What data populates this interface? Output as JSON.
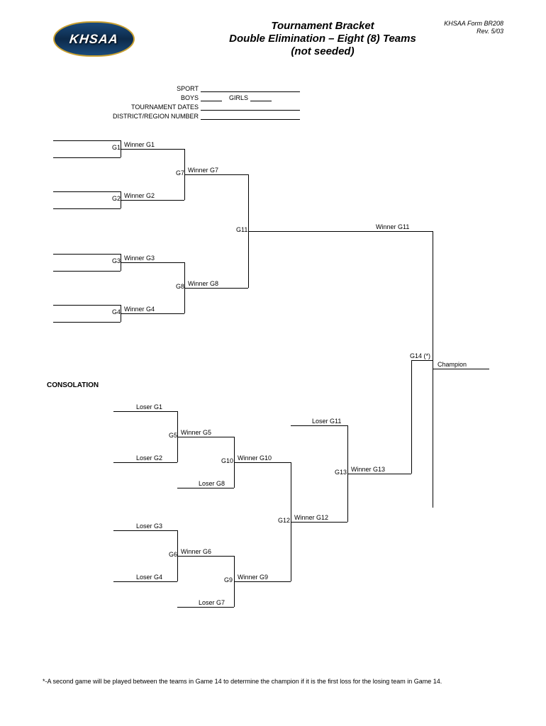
{
  "logo_text": "KHSAA",
  "form_info": {
    "form": "KHSAA Form BR208",
    "rev": "Rev. 5/03"
  },
  "title": {
    "line1": "Tournament Bracket",
    "line2": "Double Elimination – Eight (8) Teams",
    "line3": "(not seeded)"
  },
  "info": {
    "sport": "SPORT",
    "boys": "BOYS",
    "girls": "GIRLS",
    "dates": "TOURNAMENT DATES",
    "district": "DISTRICT/REGION NUMBER"
  },
  "consolation": "CONSOLATION",
  "labels": {
    "g1": "G1",
    "g2": "G2",
    "g3": "G3",
    "g4": "G4",
    "g5": "G5",
    "g6": "G6",
    "g7": "G7",
    "g8": "G8",
    "g9": "G9",
    "g10": "G10",
    "g11": "G11",
    "g12": "G12",
    "g13": "G13",
    "g14": "G14  (*)",
    "wg1": "Winner G1",
    "wg2": "Winner G2",
    "wg3": "Winner G3",
    "wg4": "Winner G4",
    "wg5": "Winner G5",
    "wg6": "Winner G6",
    "wg7": "Winner G7",
    "wg8": "Winner G8",
    "wg9": "Winner G9",
    "wg10": "Winner G10",
    "wg11": "Winner G11",
    "wg12": "Winner G12",
    "wg13": "Winner G13",
    "lg1": "Loser G1",
    "lg2": "Loser G2",
    "lg3": "Loser G3",
    "lg4": "Loser G4",
    "lg7": "Loser G7",
    "lg8": "Loser G8",
    "lg11": "Loser G11",
    "champion": "Champion"
  },
  "footnote": "*-A second game will be played between the teams in Game 14 to determine the champion if it is the first loss for the losing team in Game 14."
}
